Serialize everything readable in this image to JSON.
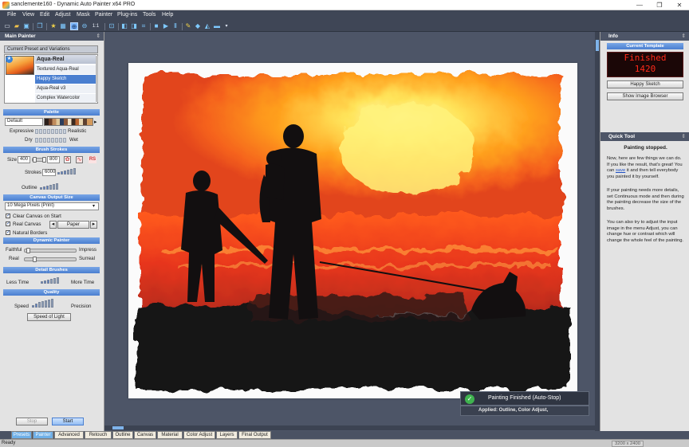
{
  "window": {
    "title": "sanclemente160 - Dynamic Auto Painter x64 PRO",
    "controls": [
      "—",
      "❐",
      "✕"
    ]
  },
  "menu": [
    "File",
    "View",
    "Edit",
    "Adjust",
    "Mask",
    "Painter",
    "Plug-ins",
    "Tools",
    "Help"
  ],
  "toolbar": {
    "zoom_ratio": "1:1"
  },
  "left_panel": {
    "title": "Main Painter",
    "pin": "⇕",
    "presets_header": "Current Preset and Variations",
    "preset_name": "Aqua-Real",
    "variations": [
      "Textured Aqua-Real",
      "Happy Sketch",
      "Aqua-Real v3",
      "Complex Watercolor"
    ],
    "selected_variation": "Happy Sketch",
    "palette": {
      "header": "Palette",
      "value": "Default",
      "expressive": "Expressive",
      "realistic": "Realistic",
      "dry": "Dry",
      "wet": "Wet"
    },
    "brush_strokes": {
      "header": "Brush Strokes",
      "size_label": "Size",
      "size_min": "400",
      "size_max": "800",
      "strokes_label": "Strokes",
      "strokes_value": "6000",
      "outline_label": "Outline",
      "rs": "RS"
    },
    "canvas_output": {
      "header": "Canvas Output Size",
      "value": "10 Mega Pixels (Print)",
      "clear_canvas": "Clear Canvas on Start",
      "real_canvas": "Real Canvas",
      "paper_value": "Paper",
      "natural_borders": "Natural Borders"
    },
    "dynamic_painter": {
      "header": "Dynamic Painter",
      "faithful": "Faithful",
      "impress": "Impress",
      "real": "Real",
      "surreal": "Surreal"
    },
    "detail_brushes": {
      "header": "Detail Brushes",
      "less_time": "Less Time",
      "more_time": "More Time"
    },
    "quality": {
      "header": "Quality",
      "speed": "Speed",
      "precision": "Precision",
      "speed_button": "Speed of Light"
    },
    "stop_button": "Stop",
    "start_button": "Start"
  },
  "right_panel": {
    "info_title": "Info",
    "pin": "⇕",
    "current_template_header": "Current Template",
    "led_line1": "Finished",
    "led_line2": "1420",
    "template_name": "Happy Sketch",
    "show_browser_button": "Show Image Browser",
    "quick_tool_title": "Quick Tool",
    "painting_stopped": "Painting stopped.",
    "para1_before": "Now, here are few things we can do. If you like the result, that's great! You can ",
    "para1_link": "save",
    "para1_after": " it and then tell everybody you painted it by yourself.",
    "para2": "If your painting needs more details, set Continuous mode and then during the painting decrease the size of the brushes.",
    "para3": "You can also try to adjust the input image in the menu Adjust, you can change hue or contrast which will change the whole feel of the painting."
  },
  "notification": {
    "title": "Painting Finished (Auto-Stop)",
    "applied": "Applied:  Outline, Color Adjust,"
  },
  "tabs": [
    "Presets",
    "Painter",
    "Advanced",
    "Retouch",
    "Outline",
    "Canvas",
    "Material",
    "Color Adjust",
    "Layers",
    "Final Output"
  ],
  "selected_tabs": [
    "Presets",
    "Painter"
  ],
  "status": {
    "text": "Ready",
    "resolution": "3200 x 2400"
  },
  "colors": {
    "ui_dark": "#4d5567",
    "accent_blue": "#4a7fd0",
    "led_red": "#ff2a1a",
    "success_green": "#3fb34f"
  }
}
